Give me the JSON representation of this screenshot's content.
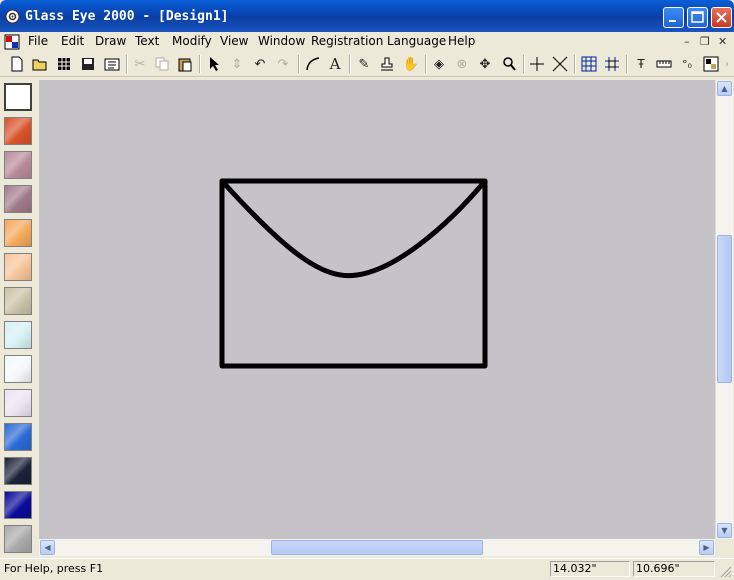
{
  "window": {
    "title": "Glass Eye 2000 - [Design1]"
  },
  "menu": {
    "items": [
      "File",
      "Edit",
      "Draw",
      "Text",
      "Modify",
      "View",
      "Window",
      "Registration",
      "Language",
      "Help"
    ]
  },
  "mdi_controls": {
    "minimize": "–",
    "restore": "❐",
    "close": "✕"
  },
  "toolbar": {
    "icons": [
      "new-icon",
      "open-icon",
      "grid-view-icon",
      "save-icon",
      "print-icon",
      "cut-icon",
      "copy-icon",
      "paste-icon",
      "pointer-icon",
      "node-edit-icon",
      "undo-icon",
      "redo-icon",
      "curve-icon",
      "text-tool-icon",
      "pencil-icon",
      "stamp-icon",
      "hand-icon",
      "fill-icon",
      "cancel-icon",
      "move-icon",
      "zoom-icon",
      "crosshair-icon",
      "x-line-icon",
      "grid-icon",
      "snap-grid-icon",
      "measure-text-icon",
      "ruler-icon",
      "nodes-icon",
      "layers-icon"
    ],
    "text_tool": "A"
  },
  "palette": {
    "swatches": [
      {
        "name": "white",
        "color": "#ffffff"
      },
      {
        "name": "streaky-red-orange",
        "color": "#d9522a"
      },
      {
        "name": "mauve-amber",
        "color": "#b88a9a"
      },
      {
        "name": "violet-amber",
        "color": "#a27a8a"
      },
      {
        "name": "orange",
        "color": "#f4a85a"
      },
      {
        "name": "peach",
        "color": "#f6c49a"
      },
      {
        "name": "beige",
        "color": "#c8c2a6"
      },
      {
        "name": "ice-blue",
        "color": "#d6f0f4"
      },
      {
        "name": "white-mist",
        "color": "#f4f8fa"
      },
      {
        "name": "lilac-white",
        "color": "#ece4f0"
      },
      {
        "name": "cobalt-blue",
        "color": "#2a6ad8"
      },
      {
        "name": "dark-navy",
        "color": "#1c2238"
      },
      {
        "name": "navy",
        "color": "#0a0a9a"
      },
      {
        "name": "grey",
        "color": "#aaaaaa"
      }
    ]
  },
  "canvas": {
    "background": "#c5c3c8",
    "stroke": "#000000"
  },
  "status": {
    "help": "For Help, press F1",
    "x_coord": "14.032\"",
    "y_coord": "10.696\""
  }
}
